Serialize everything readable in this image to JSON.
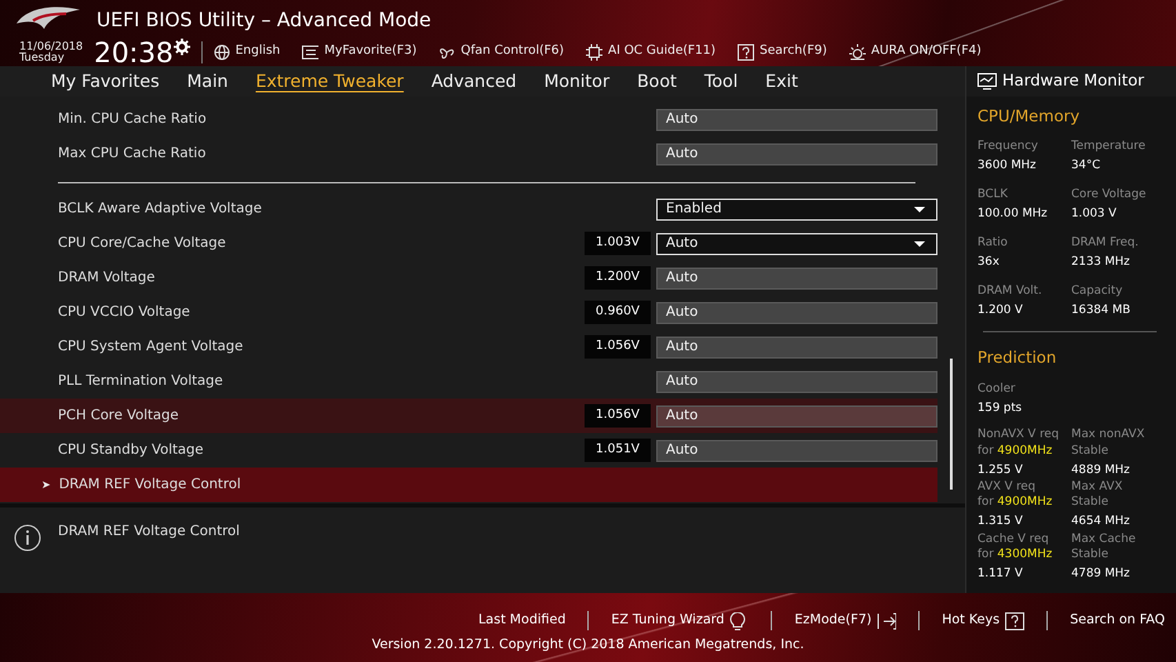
{
  "header": {
    "title": "UEFI BIOS Utility – Advanced Mode",
    "date": "11/06/2018",
    "day": "Tuesday",
    "time": "20:38",
    "toolbar": [
      {
        "label": "English"
      },
      {
        "label": "MyFavorite(F3)"
      },
      {
        "label": "Qfan Control(F6)"
      },
      {
        "label": "AI OC Guide(F11)"
      },
      {
        "label": "Search(F9)"
      },
      {
        "label": "AURA ON/OFF(F4)"
      }
    ]
  },
  "tabs": [
    {
      "label": "My Favorites",
      "selected": false
    },
    {
      "label": "Main",
      "selected": false
    },
    {
      "label": "Extreme Tweaker",
      "selected": true
    },
    {
      "label": "Advanced",
      "selected": false
    },
    {
      "label": "Monitor",
      "selected": false
    },
    {
      "label": "Boot",
      "selected": false
    },
    {
      "label": "Tool",
      "selected": false
    },
    {
      "label": "Exit",
      "selected": false
    }
  ],
  "settings": [
    {
      "kind": "field",
      "label": "Min. CPU Cache Ratio",
      "value": "Auto",
      "selected": false,
      "hovered": false
    },
    {
      "kind": "field",
      "label": "Max CPU Cache Ratio",
      "value": "Auto",
      "selected": false,
      "hovered": false
    },
    {
      "kind": "separator"
    },
    {
      "kind": "dropdown",
      "label": "BCLK Aware Adaptive Voltage",
      "value": "Enabled",
      "selected": false,
      "hovered": false
    },
    {
      "kind": "dropdown",
      "label": "CPU Core/Cache Voltage",
      "reading": "1.003V",
      "value": "Auto",
      "selected": false,
      "hovered": false
    },
    {
      "kind": "field",
      "label": "DRAM Voltage",
      "reading": "1.200V",
      "value": "Auto",
      "selected": false,
      "hovered": false
    },
    {
      "kind": "field",
      "label": "CPU VCCIO Voltage",
      "reading": "0.960V",
      "value": "Auto",
      "selected": false,
      "hovered": false
    },
    {
      "kind": "field",
      "label": "CPU System Agent Voltage",
      "reading": "1.056V",
      "value": "Auto",
      "selected": false,
      "hovered": false
    },
    {
      "kind": "field",
      "label": "PLL Termination Voltage",
      "value": "Auto",
      "selected": false,
      "hovered": false
    },
    {
      "kind": "field",
      "label": "PCH Core Voltage",
      "reading": "1.056V",
      "value": "Auto",
      "selected": false,
      "hovered": true
    },
    {
      "kind": "field",
      "label": "CPU Standby Voltage",
      "reading": "1.051V",
      "value": "Auto",
      "selected": false,
      "hovered": false
    },
    {
      "kind": "submenu",
      "label": "DRAM REF Voltage Control",
      "marker": "➤",
      "selected": true,
      "hovered": false
    }
  ],
  "help": {
    "text": "DRAM REF Voltage Control"
  },
  "hardware_monitor": {
    "title": "Hardware Monitor",
    "sections": [
      {
        "title": "CPU/Memory",
        "rows": [
          [
            {
              "label": [
                "Frequency"
              ],
              "value": "3600 MHz"
            },
            {
              "label": [
                "Temperature"
              ],
              "value": "34°C"
            }
          ],
          [
            {
              "label": [
                "BCLK"
              ],
              "value": "100.00 MHz"
            },
            {
              "label": [
                "Core Voltage"
              ],
              "value": "1.003 V"
            }
          ],
          [
            {
              "label": [
                "Ratio"
              ],
              "value": "36x"
            },
            {
              "label": [
                "DRAM Freq."
              ],
              "value": "2133 MHz"
            }
          ],
          [
            {
              "label": [
                "DRAM Volt."
              ],
              "value": "1.200 V"
            },
            {
              "label": [
                "Capacity"
              ],
              "value": "16384 MB"
            }
          ]
        ]
      },
      {
        "title": "Prediction",
        "rows": [
          [
            {
              "label": [
                "Cooler"
              ],
              "value": "159 pts"
            }
          ],
          [
            {
              "label": [
                "NonAVX V req",
                "for **4900MHz**"
              ],
              "value": "1.255 V"
            },
            {
              "label": [
                "Max nonAVX",
                "Stable"
              ],
              "value": "4889 MHz"
            }
          ],
          [
            {
              "label": [
                "AVX V req",
                "for **4900MHz**"
              ],
              "value": "1.315 V"
            },
            {
              "label": [
                "Max AVX",
                "Stable"
              ],
              "value": "4654 MHz"
            }
          ],
          [
            {
              "label": [
                "Cache V req",
                "for **4300MHz**"
              ],
              "value": "1.117 V"
            },
            {
              "label": [
                "Max Cache",
                "Stable"
              ],
              "value": "4789 MHz"
            }
          ]
        ]
      }
    ]
  },
  "footer": {
    "items": [
      {
        "label": "Last Modified"
      },
      {
        "label": "EZ Tuning Wizard"
      },
      {
        "label": "EzMode(F7)"
      },
      {
        "label": "Hot Keys"
      },
      {
        "label": "Search on FAQ"
      }
    ],
    "version": "Version 2.20.1271. Copyright (C) 2018 American Megatrends, Inc."
  }
}
